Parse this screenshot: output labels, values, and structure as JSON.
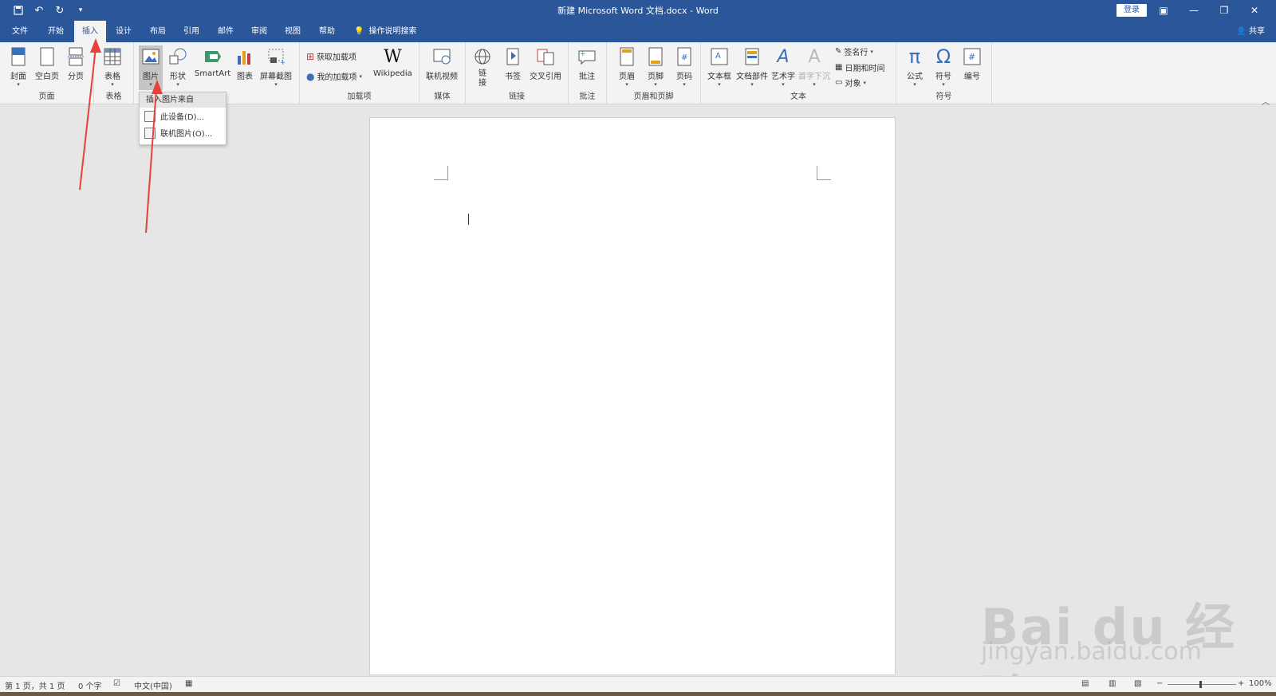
{
  "window": {
    "title": "新建 Microsoft Word 文档.docx  -  Word",
    "login": "登录"
  },
  "tabs": [
    {
      "label": "文件"
    },
    {
      "label": "开始"
    },
    {
      "label": "插入"
    },
    {
      "label": "设计"
    },
    {
      "label": "布局"
    },
    {
      "label": "引用"
    },
    {
      "label": "邮件"
    },
    {
      "label": "审阅"
    },
    {
      "label": "视图"
    },
    {
      "label": "帮助"
    },
    {
      "label": "操作说明搜索"
    }
  ],
  "active_tab": "插入",
  "share": "共享",
  "ribbon": {
    "pages": {
      "label": "页面",
      "cover": "封面",
      "blank": "空白页",
      "break": "分页"
    },
    "tables": {
      "label": "表格",
      "table": "表格"
    },
    "illustrations": {
      "picture": "图片",
      "shapes": "形状",
      "smartart": "SmartArt",
      "chart": "图表",
      "screenshot": "屏幕截图"
    },
    "addins": {
      "label": "加载项",
      "get": "获取加载项",
      "my": "我的加载项",
      "wikipedia": "Wikipedia"
    },
    "media": {
      "label": "媒体",
      "video": "联机视频"
    },
    "links": {
      "label": "链接",
      "link": "链接",
      "bookmark": "书签",
      "crossref": "交叉引用"
    },
    "comments": {
      "label": "批注",
      "comment": "批注"
    },
    "header_footer": {
      "label": "页眉和页脚",
      "header": "页眉",
      "footer": "页脚",
      "page_number": "页码"
    },
    "text": {
      "label": "文本",
      "textbox": "文本框",
      "quickparts": "文档部件",
      "wordart": "艺术字",
      "dropcap": "首字下沉",
      "signature": "签名行",
      "datetime": "日期和时间",
      "object": "对象"
    },
    "symbols": {
      "label": "符号",
      "equation": "公式",
      "symbol": "符号",
      "number": "编号"
    }
  },
  "picture_dropdown": {
    "header": "插入图片来自",
    "items": [
      {
        "label": "此设备(D)..."
      },
      {
        "label": "联机图片(O)..."
      }
    ]
  },
  "status": {
    "page": "第 1 页，共 1 页",
    "words": "0 个字",
    "lang": "中文(中国)",
    "zoom": "100%"
  },
  "watermark": {
    "brand": "Bai du 经验",
    "url": "jingyan.baidu.com"
  },
  "colors": {
    "brand": "#2b579a",
    "annotation": "#e8403a"
  }
}
